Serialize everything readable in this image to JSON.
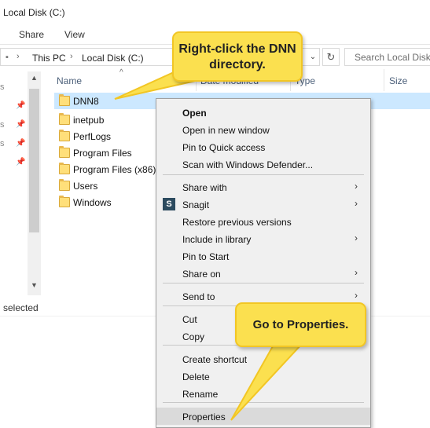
{
  "window": {
    "title": "Local Disk (C:)"
  },
  "ribbon": {
    "tabs": [
      "Share",
      "View"
    ]
  },
  "address": {
    "crumbs": [
      "This PC",
      "Local Disk (C:)"
    ],
    "dropdown_glyph": "⌄",
    "refresh_glyph": "↻",
    "search_placeholder": "Search Local Disk (C:)"
  },
  "nav": {
    "status": "selected"
  },
  "columns": {
    "name": "Name",
    "date": "Date modified",
    "type": "Type",
    "size": "Size",
    "sort_glyph": "^"
  },
  "files": [
    {
      "name": "DNN8",
      "selected": true
    },
    {
      "name": "inetpub",
      "selected": false
    },
    {
      "name": "PerfLogs",
      "selected": false
    },
    {
      "name": "Program Files",
      "selected": false
    },
    {
      "name": "Program Files (x86)",
      "selected": false
    },
    {
      "name": "Users",
      "selected": false
    },
    {
      "name": "Windows",
      "selected": false
    }
  ],
  "context_menu": {
    "items": [
      {
        "label": "Open",
        "bold": true
      },
      {
        "label": "Open in new window"
      },
      {
        "label": "Pin to Quick access"
      },
      {
        "label": "Scan with Windows Defender..."
      },
      {
        "label": "Share with",
        "submenu": true
      },
      {
        "label": "Snagit",
        "submenu": true,
        "icon": "S"
      },
      {
        "label": "Restore previous versions"
      },
      {
        "label": "Include in library",
        "submenu": true
      },
      {
        "label": "Pin to Start"
      },
      {
        "label": "Share on",
        "submenu": true
      },
      {
        "label": "Send to",
        "submenu": true
      },
      {
        "label": "Cut"
      },
      {
        "label": "Copy"
      },
      {
        "label": "Create shortcut"
      },
      {
        "label": "Delete"
      },
      {
        "label": "Rename"
      },
      {
        "label": "Properties",
        "hover": true
      }
    ],
    "submenu_glyph": "›"
  },
  "callouts": {
    "top": "Right-click the DNN directory.",
    "bottom": "Go to Properties."
  },
  "colors": {
    "callout_fill": "#fbe04f",
    "selection": "#cce8ff",
    "menu_bg": "#f0f0f0"
  }
}
